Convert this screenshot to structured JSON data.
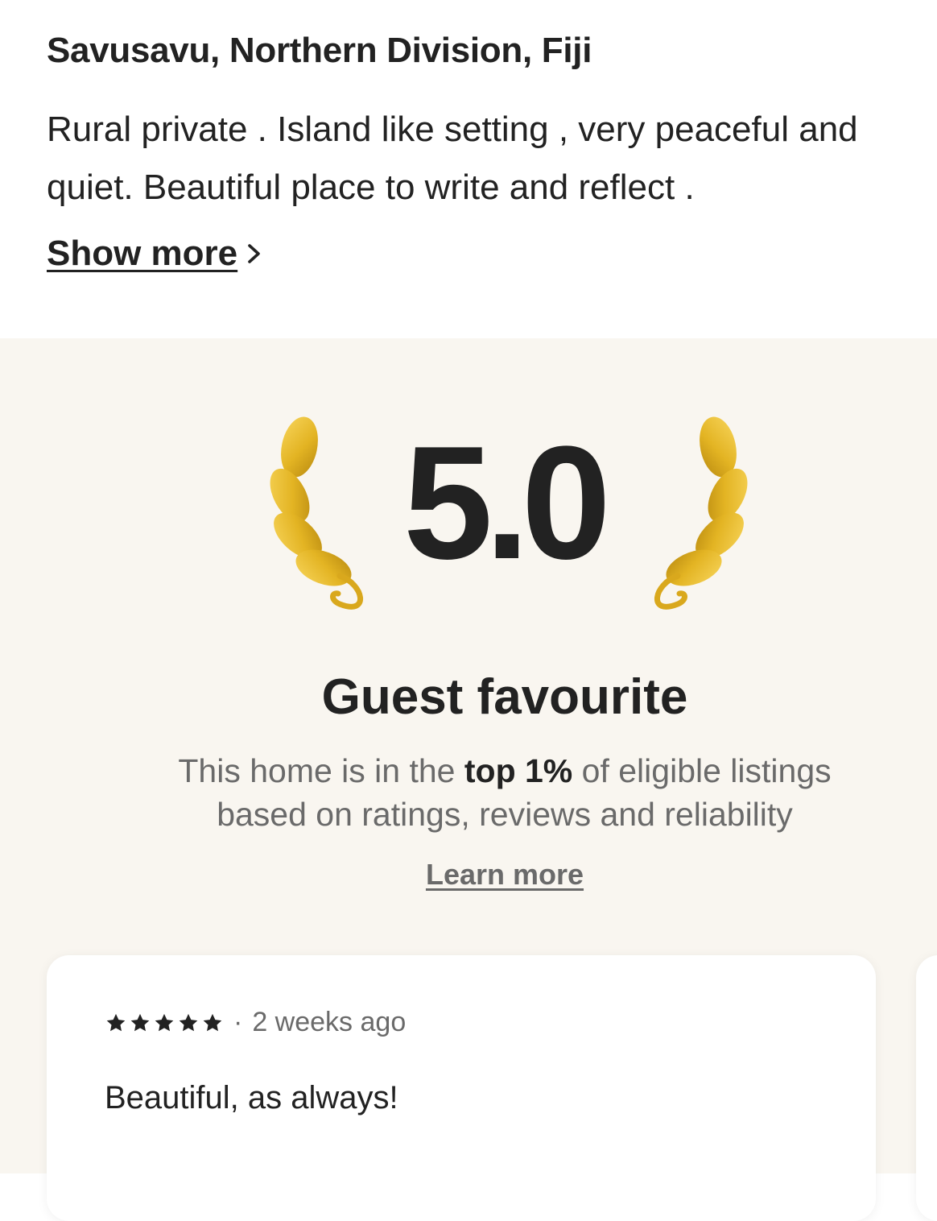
{
  "listing": {
    "location": "Savusavu, Northern Division, Fiji",
    "description_lines": [
      "Rural private . Island like setting , very peaceful and",
      "quiet. Beautiful place to write and reflect ."
    ],
    "show_more_label": "Show more"
  },
  "guest_favourite": {
    "rating": "5.0",
    "title": "Guest favourite",
    "desc_before": "This home is in the ",
    "desc_highlight": "top 1%",
    "desc_after": " of eligible listings",
    "desc_line2": "based on ratings, reviews and reliability",
    "learn_more_label": "Learn more"
  },
  "review": {
    "stars": 5,
    "separator": "·",
    "time_ago": "2 weeks ago",
    "text": "Beautiful, as always!"
  },
  "colors": {
    "text_primary": "#222222",
    "text_secondary": "#6a6a6a",
    "section_bg": "#f9f6f0",
    "laurel_gold": "#e3b423"
  },
  "icons": {
    "show_more": "chevron-right-icon",
    "laurel": "laurel-icon",
    "star": "star-icon"
  }
}
